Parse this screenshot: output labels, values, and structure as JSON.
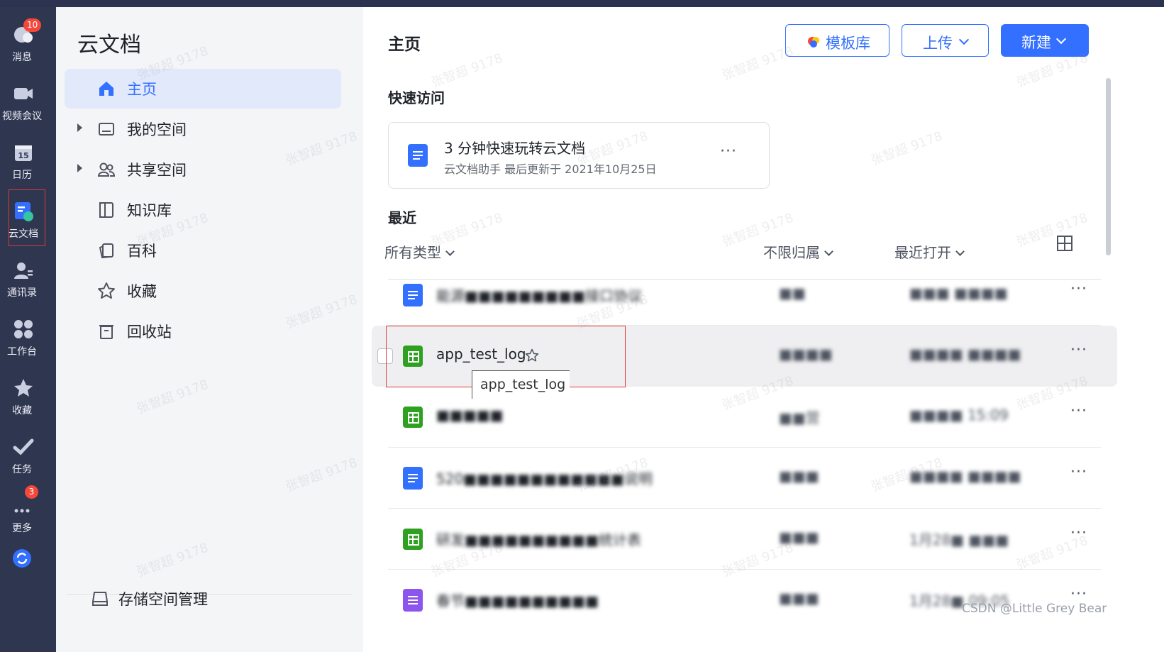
{
  "rail": {
    "items": [
      {
        "label": "消息",
        "icon": "chat-bubble-icon",
        "badge": "10"
      },
      {
        "label": "视频会议",
        "icon": "video-camera-icon"
      },
      {
        "label": "日历",
        "icon": "calendar-icon",
        "icon_text": "15"
      },
      {
        "label": "云文档",
        "icon": "cloud-doc-icon"
      },
      {
        "label": "通讯录",
        "icon": "contacts-icon"
      },
      {
        "label": "工作台",
        "icon": "workbench-grid-icon"
      },
      {
        "label": "收藏",
        "icon": "star-icon"
      },
      {
        "label": "任务",
        "icon": "checkmark-icon"
      },
      {
        "label": "更多",
        "icon": "more-dots-icon",
        "badge": "3"
      }
    ],
    "bottom_icon": "sync-icon"
  },
  "nav": {
    "title": "云文档",
    "items": [
      {
        "label": "主页",
        "icon": "home-icon",
        "active": true
      },
      {
        "label": "我的空间",
        "icon": "folder-icon"
      },
      {
        "label": "共享空间",
        "icon": "people-icon"
      },
      {
        "label": "知识库",
        "icon": "book-icon"
      },
      {
        "label": "百科",
        "icon": "cards-icon"
      },
      {
        "label": "收藏",
        "icon": "star-outline-icon"
      },
      {
        "label": "回收站",
        "icon": "trash-icon"
      }
    ],
    "storage_label": "存储空间管理"
  },
  "main": {
    "title": "主页",
    "buttons": {
      "template": "模板库",
      "upload": "上传",
      "new": "新建"
    },
    "quick_access": {
      "heading": "快速访问",
      "card_title": "3 分钟快速玩转云文档",
      "card_subtitle": "云文档助手  最后更新于 2021年10月25日"
    },
    "recent": {
      "heading": "最近",
      "filters": {
        "type": "所有类型",
        "owner": "不限归属",
        "sort": "最近打开"
      },
      "rows": [
        {
          "name": "能源■■■■■■■■■接口协议",
          "owner": "■■",
          "time": "■■■ ■■■■",
          "icon": "doc-icon"
        },
        {
          "name": "app_test_log",
          "owner": "■■■■",
          "time": "■■■■ ■■■■",
          "icon": "sheet-icon",
          "hover": true
        },
        {
          "name": "■■■■■",
          "owner": "■■营",
          "time": "■■■■ 15:09",
          "icon": "sheet-icon"
        },
        {
          "name": "520■■■■■■■■■■■■说明",
          "owner": "■■■",
          "time": "■■■■ ■■■■",
          "icon": "doc-multi-icon"
        },
        {
          "name": "研发■■■■■■■■■■统计表",
          "owner": "■■■",
          "time": "1月28■ ■■■",
          "icon": "sheet-badge-icon"
        },
        {
          "name": "春节■■■■■■■■■■",
          "owner": "■■■",
          "time": "1月28■ 09:05",
          "icon": "list-icon"
        }
      ],
      "tooltip": "app_test_log"
    }
  },
  "watermark_text": "张智超 9178",
  "credit": "CSDN @Little Grey Bear",
  "colors": {
    "accent": "#3370ff",
    "rail_bg": "#2e3650",
    "nav_bg": "#f4f5f7",
    "sheet_green": "#2ea121",
    "doc_blue": "#3370ff",
    "list_purple": "#8d55ed"
  }
}
